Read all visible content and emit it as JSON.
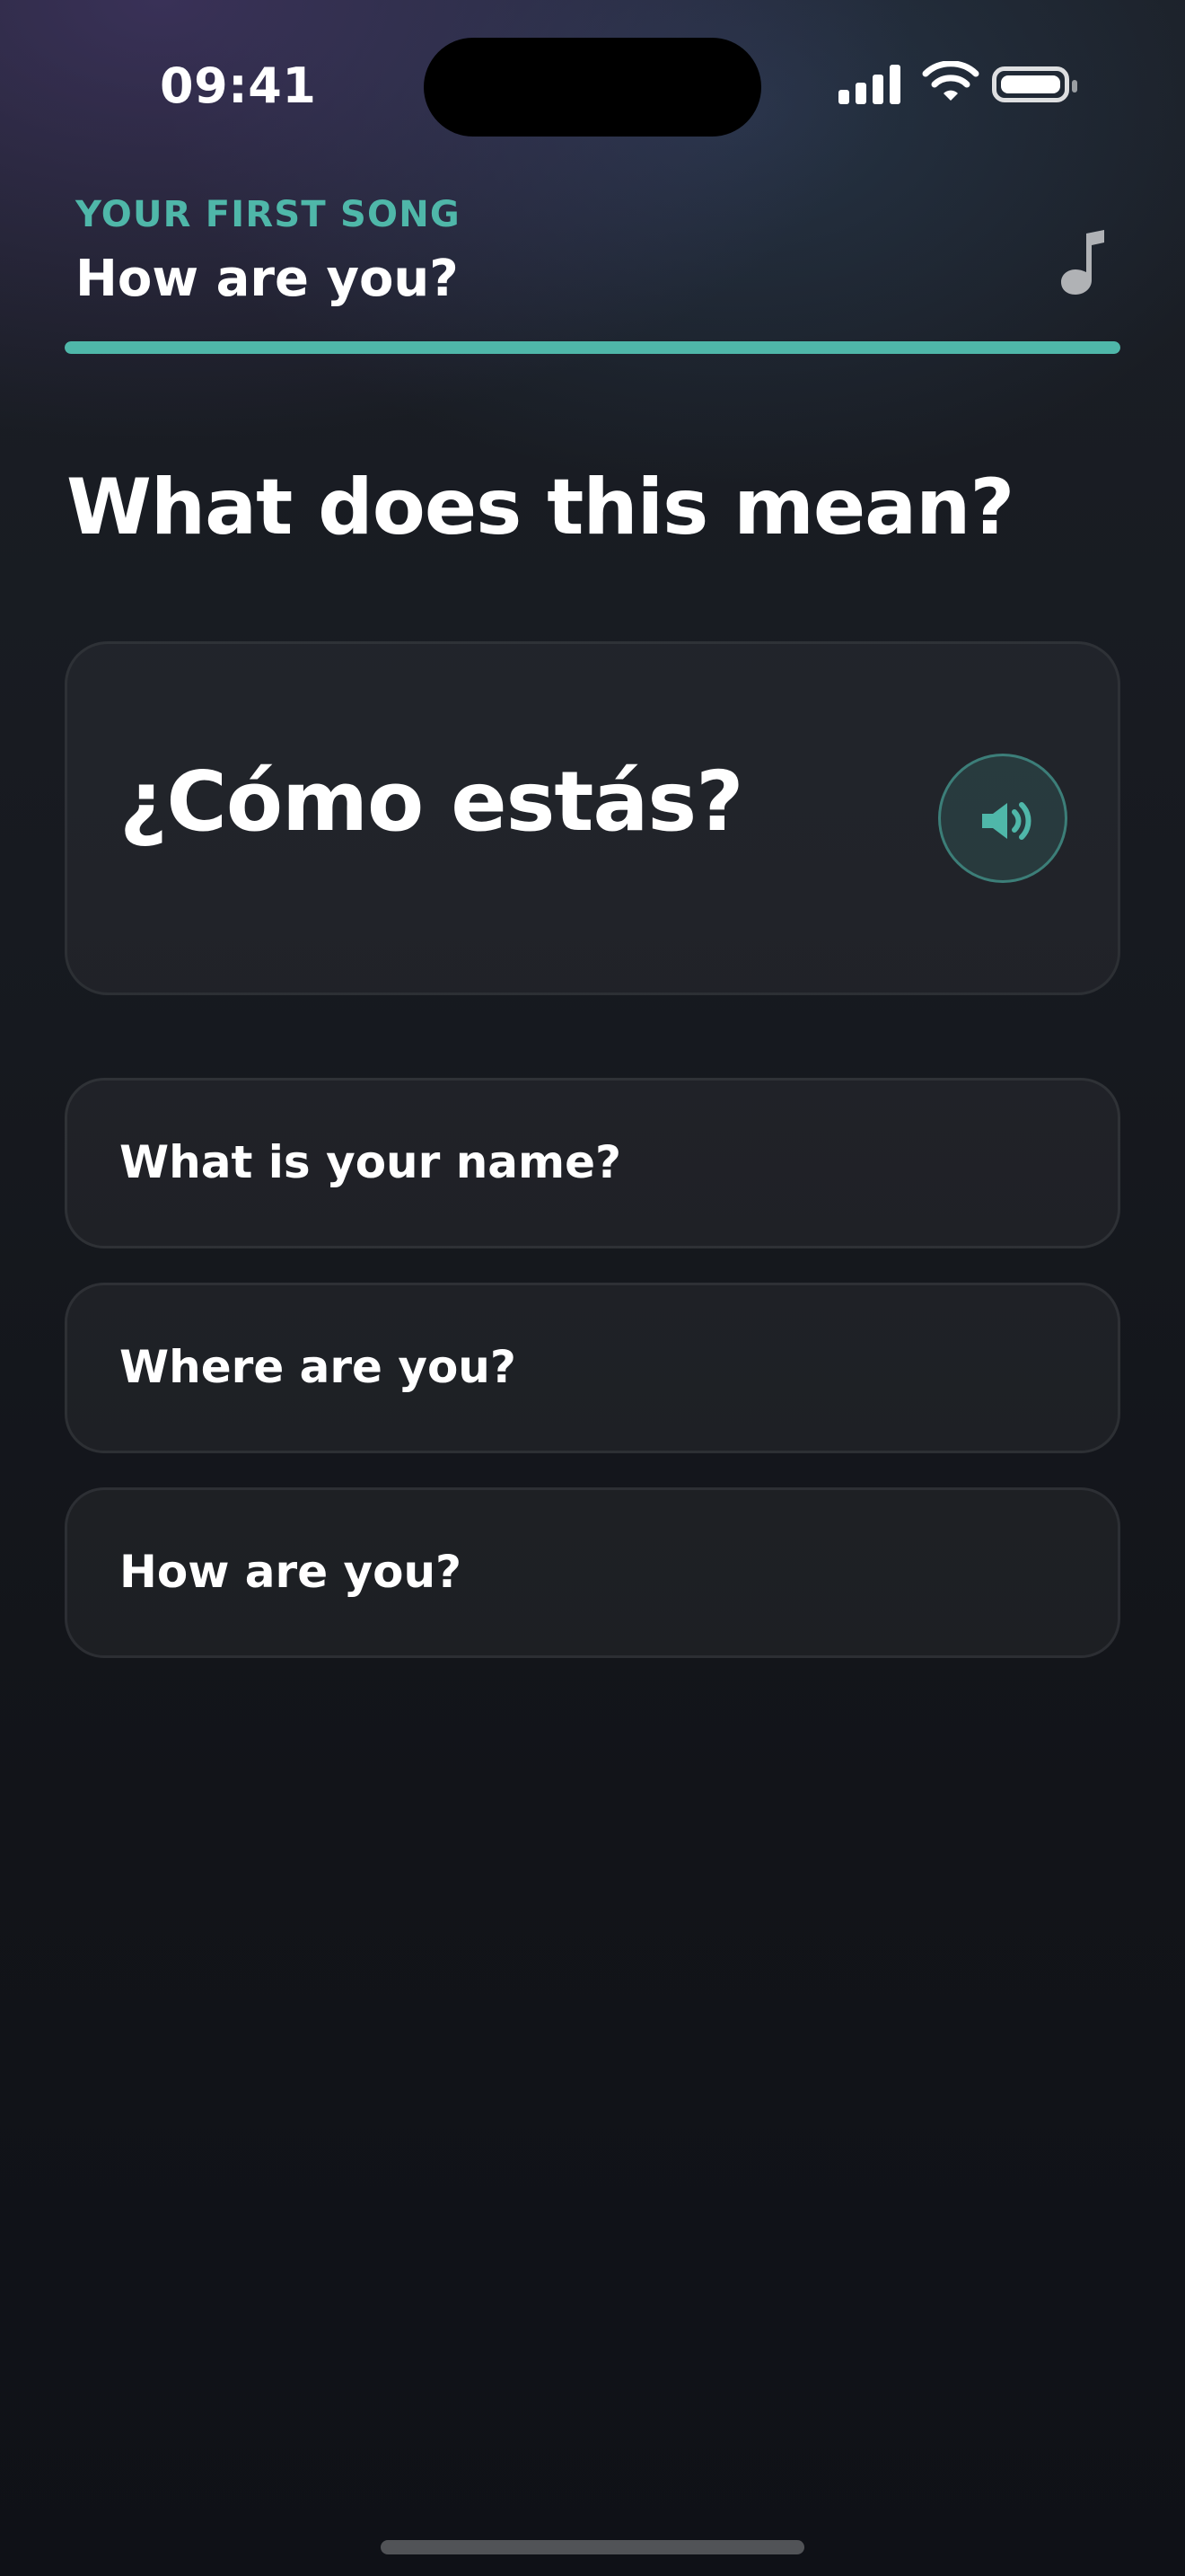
{
  "status_bar": {
    "time": "09:41",
    "icons": [
      "signal-icon",
      "wifi-icon",
      "battery-icon"
    ]
  },
  "lesson": {
    "kicker": "YOUR FIRST SONG",
    "title": "How are you?",
    "header_icon": "music-note-icon",
    "progress_percent": 100
  },
  "quiz": {
    "prompt": "What does this mean?",
    "phrase": "¿Cómo estás?",
    "audio_icon": "speaker-icon",
    "options": [
      {
        "label": "What is your name?"
      },
      {
        "label": "Where are you?"
      },
      {
        "label": "How are you?"
      }
    ]
  },
  "colors": {
    "accent": "#4fb7a9",
    "background_top": "#1b1f26",
    "background_bottom": "#0f1117",
    "card": "rgba(255,255,255,0.045)",
    "text": "#ffffff"
  }
}
